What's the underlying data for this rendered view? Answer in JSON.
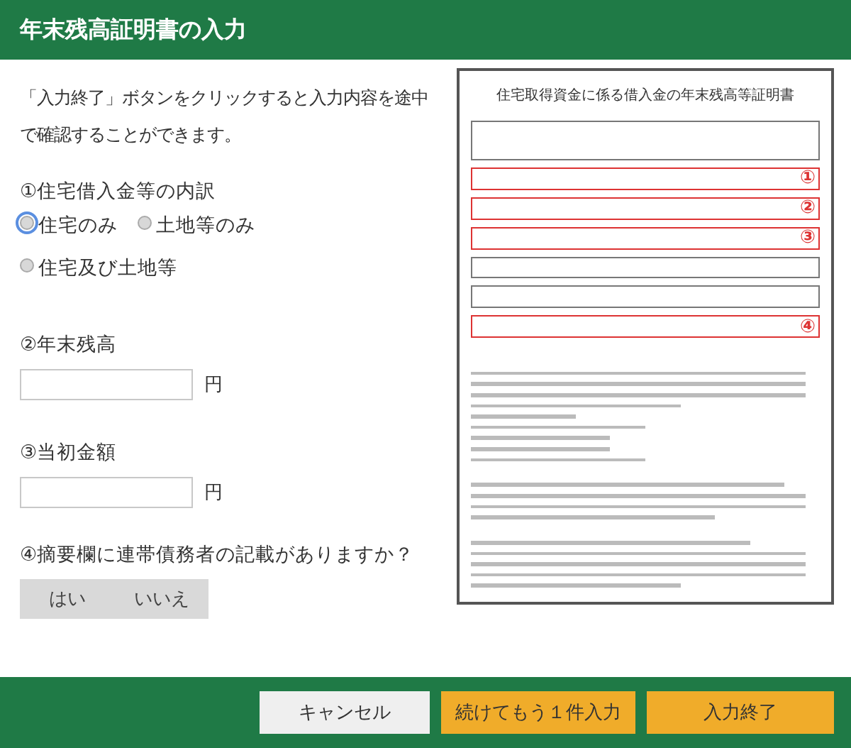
{
  "header": {
    "title": "年末残高証明書の入力"
  },
  "intro": "「入力終了」ボタンをクリックすると入力内容を途中で確認することができます。",
  "breakdown": {
    "label": "①住宅借入金等の内訳",
    "options": [
      {
        "label": "住宅のみ",
        "selected": false,
        "focused": true
      },
      {
        "label": "土地等のみ",
        "selected": false,
        "focused": false
      },
      {
        "label": "住宅及び土地等",
        "selected": false,
        "focused": false
      }
    ]
  },
  "amounts": [
    {
      "label": "②年末残高",
      "unit": "円"
    },
    {
      "label": "③当初金額",
      "unit": "円"
    }
  ],
  "co_debtor": {
    "label": "④摘要欄に連帯債務者の記載がありますか？",
    "options": [
      {
        "label": "はい",
        "selected": false
      },
      {
        "label": "いいえ",
        "selected": false
      }
    ]
  },
  "document": {
    "title": "住宅取得資金に係る借入金の年末残高等証明書",
    "markers": [
      "①",
      "②",
      "③",
      "④"
    ]
  },
  "footer": {
    "buttons": [
      {
        "label": "キャンセル",
        "kind": "secondary"
      },
      {
        "label": "続けてもう１件入力",
        "kind": "primary"
      },
      {
        "label": "入力終了",
        "kind": "primary"
      }
    ]
  }
}
